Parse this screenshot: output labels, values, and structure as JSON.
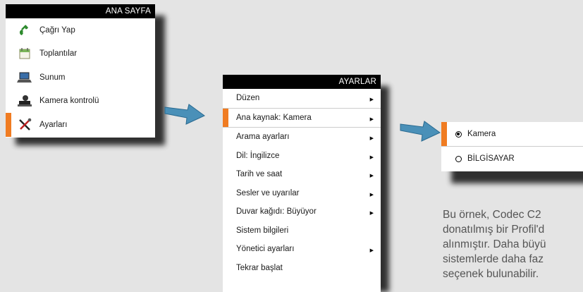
{
  "home_menu": {
    "title": "ANA SAYFA",
    "items": [
      {
        "label": "Çağrı Yap",
        "icon": "phone-icon"
      },
      {
        "label": "Toplantılar",
        "icon": "calendar-icon"
      },
      {
        "label": "Sunum",
        "icon": "laptop-icon"
      },
      {
        "label": "Kamera kontrolü",
        "icon": "camera-icon"
      },
      {
        "label": "Ayarları",
        "icon": "tools-icon"
      }
    ]
  },
  "settings_menu": {
    "title": "AYARLAR",
    "items": [
      {
        "label": "Düzen"
      },
      {
        "label": "Ana kaynak: Kamera"
      },
      {
        "label": "Arama ayarları"
      },
      {
        "label": "Dil: İngilizce"
      },
      {
        "label": "Tarih ve saat"
      },
      {
        "label": "Sesler ve uyarılar"
      },
      {
        "label": "Duvar kağıdı: Büyüyor"
      },
      {
        "label": "Sistem bilgileri"
      },
      {
        "label": "Yönetici ayarları"
      },
      {
        "label": "Tekrar başlat"
      }
    ]
  },
  "source_menu": {
    "options": [
      {
        "label": "Kamera",
        "selected": true
      },
      {
        "label": "BİLGİSAYAR",
        "selected": false
      }
    ]
  },
  "caption": "Bu örnek, Codec C2\ndonatılmış bir Profil'd\nalınmıştır. Daha büyü\nsistemlerde daha faz\nseçenek bulunabilir.",
  "colors": {
    "accent": "#f07c22",
    "arrow": "#4a90b8",
    "titlebar": "#000000"
  }
}
